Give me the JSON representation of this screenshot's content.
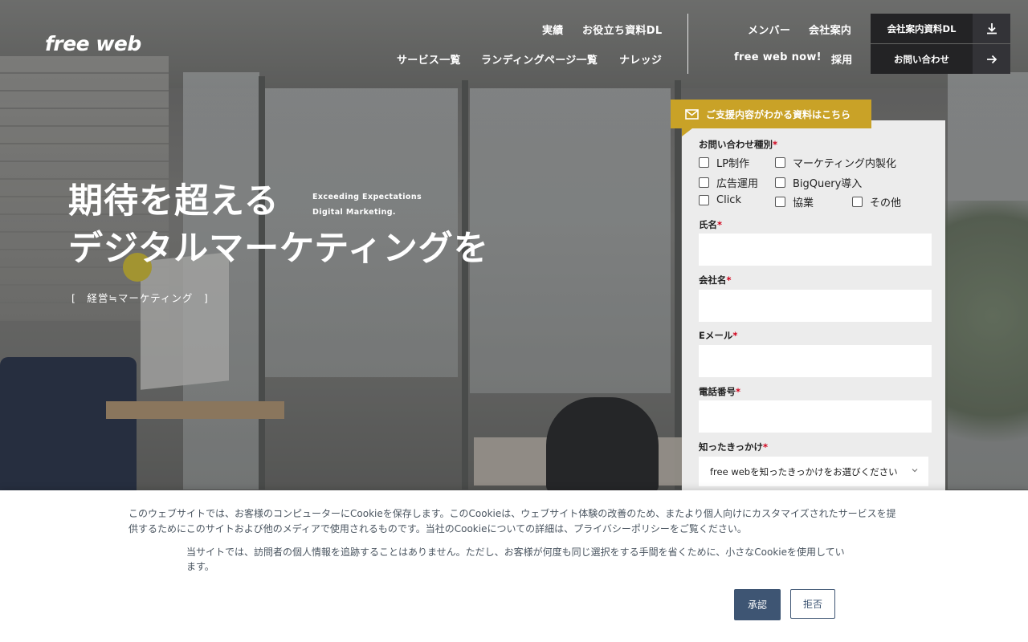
{
  "brand": {
    "logo": "free web"
  },
  "nav": {
    "row1": [
      "実績",
      "お役立ち資料DL",
      "メンバー",
      "会社案内"
    ],
    "row2": [
      "サービス一覧",
      "ランディングページ一覧",
      "ナレッジ",
      "free web now!",
      "採用"
    ]
  },
  "cta": {
    "download": {
      "label": "会社案内資料DL",
      "icon": "download-icon"
    },
    "contact": {
      "label": "お問い合わせ",
      "icon": "arrow-right-icon"
    }
  },
  "hero": {
    "title_line1": "期待を超える",
    "title_line2": "デジタルマーケティングを",
    "sub_line1": "Exceeding Expectations",
    "sub_line2": "Digital Marketing.",
    "tag": "[　経営≒マーケティング　]"
  },
  "form": {
    "ribbon": "ご支援内容がわかる資料はこちら",
    "ribbon_icon": "mail-icon",
    "inquiry_type_label": "お問い合わせ種別",
    "required_mark": "*",
    "checkboxes": [
      "LP制作",
      "マーケティング内製化",
      "広告運用",
      "BigQuery導入",
      "Click",
      "協業",
      "その他"
    ],
    "name_label": "氏名",
    "company_label": "会社名",
    "email_label": "Eメール",
    "phone_label": "電話番号",
    "source_label": "知ったきっかけ",
    "source_select_value": "free webを知ったきっかけをお選びください"
  },
  "cookie": {
    "text1": "このウェブサイトでは、お客様のコンピューターにCookieを保存します。このCookieは、ウェブサイト体験の改善のため、またより個人向けにカスタマイズされたサービスを提供するためにこのサイトおよび他のメディアで使用されるものです。当社のCookieについての詳細は、プライバシーポリシーをご覧ください。",
    "text2": "当サイトでは、訪問者の個人情報を追跡することはありません。ただし、お客様が何度も同じ選択をする手間を省くために、小さなCookieを使用しています。",
    "accept": "承認",
    "decline": "拒否"
  },
  "colors": {
    "accent_gold": "#c9a227",
    "cta_dark": "#232325",
    "cookie_button": "#3e5573",
    "required": "#d0021b"
  }
}
